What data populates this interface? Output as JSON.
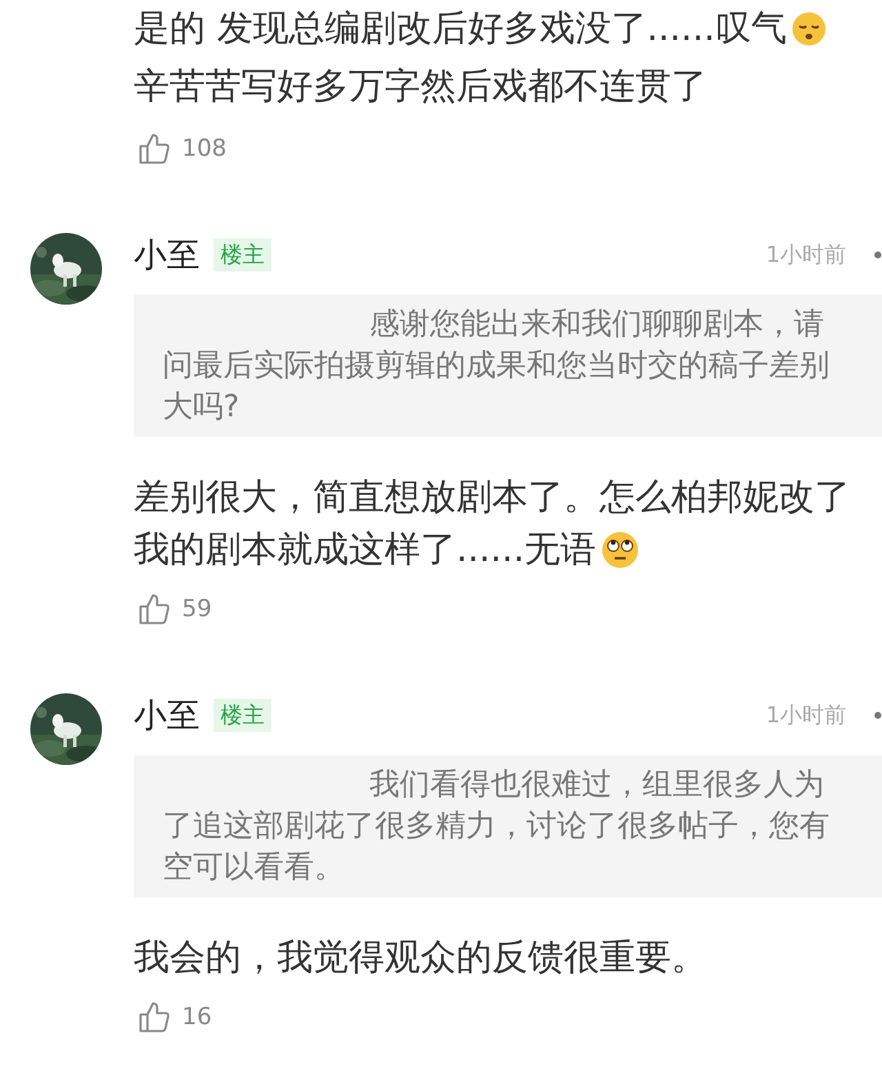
{
  "comments": [
    {
      "body": [
        {
          "text": "是的 发现总编剧改后好多戏没了......叹气",
          "kind": "sigh"
        },
        {
          "text": "辛苦苦写好多万字然后戏都不连贯了",
          "kind": "plain"
        }
      ],
      "likes": "108"
    },
    {
      "author": "小至",
      "badge": "楼主",
      "time": "1小时前",
      "quote": [
        "感谢您能出来和我们聊聊剧本，请",
        "问最后实际拍摄剪辑的成果和您当时交的稿子差别",
        "大吗?"
      ],
      "body": [
        {
          "text": "差别很大，简直想放剧本了。怎么柏邦妮改了",
          "kind": "plain"
        },
        {
          "text": "我的剧本就成这样了......无语",
          "kind": "rolleyes"
        }
      ],
      "likes": "59"
    },
    {
      "author": "小至",
      "badge": "楼主",
      "time": "1小时前",
      "quote": [
        "我们看得也很难过，组里很多人为",
        "了追这部剧花了很多精力，讨论了很多帖子，您有",
        "空可以看看。"
      ],
      "body": [
        {
          "text": "我会的，我觉得观众的反馈很重要。",
          "kind": "plain"
        }
      ],
      "likes": "16"
    }
  ]
}
